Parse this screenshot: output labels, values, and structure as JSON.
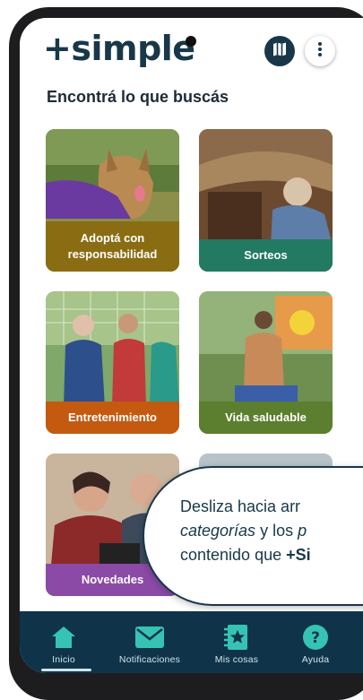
{
  "app": {
    "logo_text": "+simple",
    "section_title": "Encontrá lo que buscás"
  },
  "header": {
    "map_icon": "map-icon",
    "more_icon": "more-vertical-icon"
  },
  "categories": [
    {
      "label": "Adoptá con responsabilidad",
      "color": "#8a6d12"
    },
    {
      "label": "Sorteos",
      "color": "#237a63"
    },
    {
      "label": "Entretenimiento",
      "color": "#c45a10"
    },
    {
      "label": "Vida saludable",
      "color": "#5b7f2e"
    },
    {
      "label": "Novedades",
      "color": "#8a4aa6"
    },
    {
      "label": "",
      "color": "#4b6b8a"
    }
  ],
  "tooltip": {
    "line1": "Desliza hacia arr",
    "line2_em": "categorías",
    "line2_mid": " y los ",
    "line2_end": "p",
    "line3_start": "contenido que ",
    "line3_strong": "+Si"
  },
  "nav": {
    "home": "Inicio",
    "notifications": "Notificaciones",
    "mine": "Mis cosas",
    "help": "Ayuda"
  },
  "colors": {
    "brand_dark": "#18384a",
    "nav_bg": "#0f3449",
    "nav_icon": "#36c3b4"
  }
}
